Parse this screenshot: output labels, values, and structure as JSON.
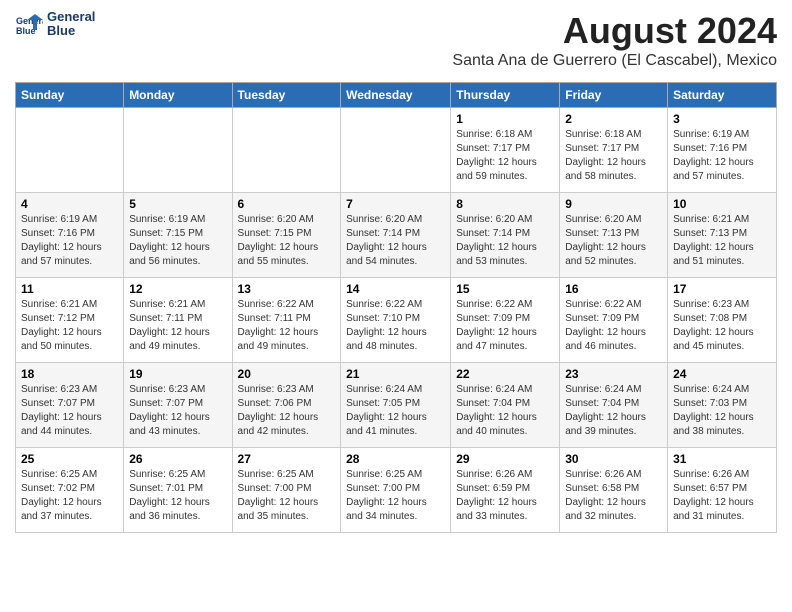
{
  "header": {
    "logo_line1": "General",
    "logo_line2": "Blue",
    "month_title": "August 2024",
    "location": "Santa Ana de Guerrero (El Cascabel), Mexico"
  },
  "days_of_week": [
    "Sunday",
    "Monday",
    "Tuesday",
    "Wednesday",
    "Thursday",
    "Friday",
    "Saturday"
  ],
  "weeks": [
    [
      {
        "day": "",
        "info": ""
      },
      {
        "day": "",
        "info": ""
      },
      {
        "day": "",
        "info": ""
      },
      {
        "day": "",
        "info": ""
      },
      {
        "day": "1",
        "info": "Sunrise: 6:18 AM\nSunset: 7:17 PM\nDaylight: 12 hours\nand 59 minutes."
      },
      {
        "day": "2",
        "info": "Sunrise: 6:18 AM\nSunset: 7:17 PM\nDaylight: 12 hours\nand 58 minutes."
      },
      {
        "day": "3",
        "info": "Sunrise: 6:19 AM\nSunset: 7:16 PM\nDaylight: 12 hours\nand 57 minutes."
      }
    ],
    [
      {
        "day": "4",
        "info": "Sunrise: 6:19 AM\nSunset: 7:16 PM\nDaylight: 12 hours\nand 57 minutes."
      },
      {
        "day": "5",
        "info": "Sunrise: 6:19 AM\nSunset: 7:15 PM\nDaylight: 12 hours\nand 56 minutes."
      },
      {
        "day": "6",
        "info": "Sunrise: 6:20 AM\nSunset: 7:15 PM\nDaylight: 12 hours\nand 55 minutes."
      },
      {
        "day": "7",
        "info": "Sunrise: 6:20 AM\nSunset: 7:14 PM\nDaylight: 12 hours\nand 54 minutes."
      },
      {
        "day": "8",
        "info": "Sunrise: 6:20 AM\nSunset: 7:14 PM\nDaylight: 12 hours\nand 53 minutes."
      },
      {
        "day": "9",
        "info": "Sunrise: 6:20 AM\nSunset: 7:13 PM\nDaylight: 12 hours\nand 52 minutes."
      },
      {
        "day": "10",
        "info": "Sunrise: 6:21 AM\nSunset: 7:13 PM\nDaylight: 12 hours\nand 51 minutes."
      }
    ],
    [
      {
        "day": "11",
        "info": "Sunrise: 6:21 AM\nSunset: 7:12 PM\nDaylight: 12 hours\nand 50 minutes."
      },
      {
        "day": "12",
        "info": "Sunrise: 6:21 AM\nSunset: 7:11 PM\nDaylight: 12 hours\nand 49 minutes."
      },
      {
        "day": "13",
        "info": "Sunrise: 6:22 AM\nSunset: 7:11 PM\nDaylight: 12 hours\nand 49 minutes."
      },
      {
        "day": "14",
        "info": "Sunrise: 6:22 AM\nSunset: 7:10 PM\nDaylight: 12 hours\nand 48 minutes."
      },
      {
        "day": "15",
        "info": "Sunrise: 6:22 AM\nSunset: 7:09 PM\nDaylight: 12 hours\nand 47 minutes."
      },
      {
        "day": "16",
        "info": "Sunrise: 6:22 AM\nSunset: 7:09 PM\nDaylight: 12 hours\nand 46 minutes."
      },
      {
        "day": "17",
        "info": "Sunrise: 6:23 AM\nSunset: 7:08 PM\nDaylight: 12 hours\nand 45 minutes."
      }
    ],
    [
      {
        "day": "18",
        "info": "Sunrise: 6:23 AM\nSunset: 7:07 PM\nDaylight: 12 hours\nand 44 minutes."
      },
      {
        "day": "19",
        "info": "Sunrise: 6:23 AM\nSunset: 7:07 PM\nDaylight: 12 hours\nand 43 minutes."
      },
      {
        "day": "20",
        "info": "Sunrise: 6:23 AM\nSunset: 7:06 PM\nDaylight: 12 hours\nand 42 minutes."
      },
      {
        "day": "21",
        "info": "Sunrise: 6:24 AM\nSunset: 7:05 PM\nDaylight: 12 hours\nand 41 minutes."
      },
      {
        "day": "22",
        "info": "Sunrise: 6:24 AM\nSunset: 7:04 PM\nDaylight: 12 hours\nand 40 minutes."
      },
      {
        "day": "23",
        "info": "Sunrise: 6:24 AM\nSunset: 7:04 PM\nDaylight: 12 hours\nand 39 minutes."
      },
      {
        "day": "24",
        "info": "Sunrise: 6:24 AM\nSunset: 7:03 PM\nDaylight: 12 hours\nand 38 minutes."
      }
    ],
    [
      {
        "day": "25",
        "info": "Sunrise: 6:25 AM\nSunset: 7:02 PM\nDaylight: 12 hours\nand 37 minutes."
      },
      {
        "day": "26",
        "info": "Sunrise: 6:25 AM\nSunset: 7:01 PM\nDaylight: 12 hours\nand 36 minutes."
      },
      {
        "day": "27",
        "info": "Sunrise: 6:25 AM\nSunset: 7:00 PM\nDaylight: 12 hours\nand 35 minutes."
      },
      {
        "day": "28",
        "info": "Sunrise: 6:25 AM\nSunset: 7:00 PM\nDaylight: 12 hours\nand 34 minutes."
      },
      {
        "day": "29",
        "info": "Sunrise: 6:26 AM\nSunset: 6:59 PM\nDaylight: 12 hours\nand 33 minutes."
      },
      {
        "day": "30",
        "info": "Sunrise: 6:26 AM\nSunset: 6:58 PM\nDaylight: 12 hours\nand 32 minutes."
      },
      {
        "day": "31",
        "info": "Sunrise: 6:26 AM\nSunset: 6:57 PM\nDaylight: 12 hours\nand 31 minutes."
      }
    ]
  ]
}
